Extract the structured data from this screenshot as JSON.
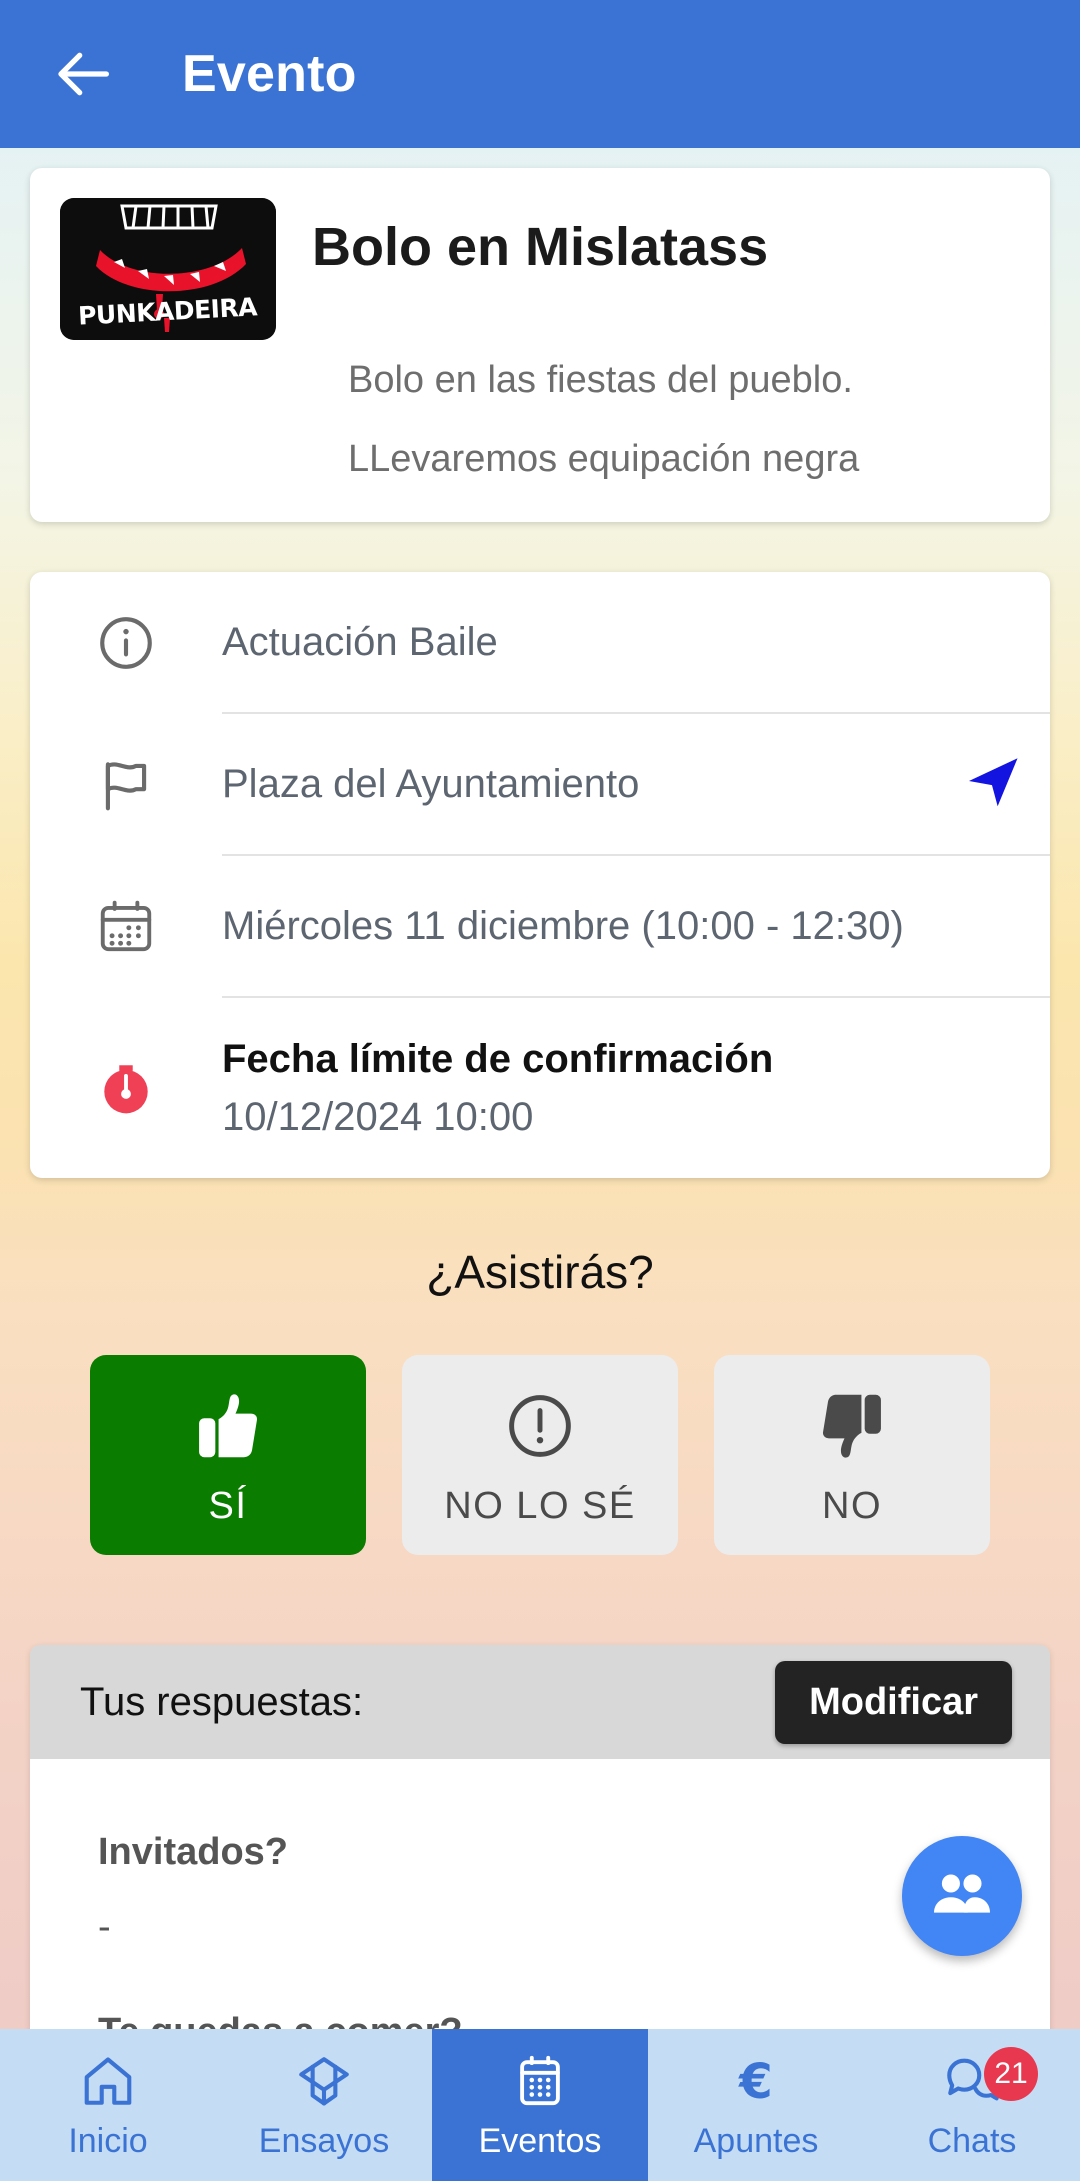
{
  "header": {
    "title": "Evento",
    "back_icon": "arrow-left-icon",
    "background_color": "#3b73d4"
  },
  "event": {
    "logo_alt": "PUNKADEIRA",
    "logo_text": "PUNKADEIRA",
    "title": "Bolo en Mislatass",
    "description_line1": "Bolo en las fiestas del pueblo.",
    "description_line2": "LLevaremos equipación negra"
  },
  "details": [
    {
      "icon": "info-circle-icon",
      "text": "Actuación Baile",
      "has_nav": false
    },
    {
      "icon": "flag-icon",
      "text": "Plaza del Ayuntamiento",
      "has_nav": true,
      "nav_icon": "navigation-arrow-icon",
      "nav_color": "#1414e0"
    },
    {
      "icon": "calendar-icon",
      "text": "Miércoles 11 diciembre (10:00 - 12:30)",
      "has_nav": false
    },
    {
      "icon": "stopwatch-icon",
      "icon_color": "#ef4056",
      "strong": "Fecha límite de confirmación",
      "text": "10/12/2024 10:00",
      "has_nav": false
    }
  ],
  "attendance": {
    "question": "¿Asistirás?",
    "options": [
      {
        "id": "yes",
        "label": "SÍ",
        "icon": "thumbs-up-icon",
        "selected": true,
        "bg": "#0a7d00"
      },
      {
        "id": "maybe",
        "label": "NO LO SÉ",
        "icon": "exclamation-circle-icon",
        "selected": false,
        "bg": "#ececec"
      },
      {
        "id": "no",
        "label": "NO",
        "icon": "thumbs-down-icon",
        "selected": false,
        "bg": "#ececec"
      }
    ]
  },
  "answers": {
    "title": "Tus respuestas:",
    "modify_label": "Modificar",
    "questions": [
      {
        "label": "Invitados?",
        "value": "-"
      },
      {
        "label": "Te quedas a comer?",
        "value": ""
      }
    ],
    "guests_fab_icon": "people-group-icon"
  },
  "bottom_nav": {
    "items": [
      {
        "label": "Inicio",
        "icon": "home-icon",
        "active": false,
        "badge": ""
      },
      {
        "label": "Ensayos",
        "icon": "graduation-cap-icon",
        "active": false,
        "badge": ""
      },
      {
        "label": "Eventos",
        "icon": "calendar-icon",
        "active": true,
        "badge": ""
      },
      {
        "label": "Apuntes",
        "icon": "euro-icon",
        "active": false,
        "badge": ""
      },
      {
        "label": "Chats",
        "icon": "chat-bubbles-icon",
        "active": false,
        "badge": "21"
      }
    ],
    "active_color": "#3b73d4",
    "background_color": "#c5ddf4",
    "badge_color": "#e8384f"
  }
}
